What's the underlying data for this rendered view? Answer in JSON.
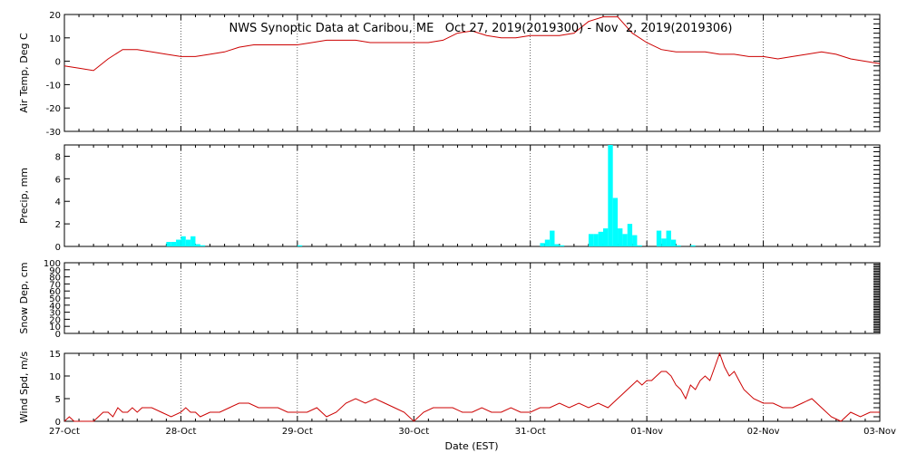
{
  "chart_data": {
    "type": "line",
    "title": "NWS Synoptic Data at Caribou, ME   Oct 27, 2019(2019300) - Nov  2, 2019(2019306)",
    "xlabel": "Date (EST)",
    "x_ticks": [
      "27-Oct",
      "28-Oct",
      "29-Oct",
      "30-Oct",
      "31-Oct",
      "01-Nov",
      "02-Nov",
      "03-Nov"
    ],
    "x_range_hours": [
      0,
      168
    ],
    "grid": "dotted at day boundaries",
    "panels": [
      {
        "id": "air-temp",
        "type": "line",
        "ylabel": "Air Temp, Deg C",
        "ylim": [
          -30,
          20
        ],
        "yticks": [
          -30,
          -20,
          -10,
          0,
          10,
          20
        ],
        "color": "#cc0000",
        "series": [
          {
            "x": [
              0,
              3,
              6,
              9,
              12,
              15,
              18,
              21,
              24,
              27,
              30,
              33,
              36,
              39,
              42,
              45,
              48,
              51,
              54,
              57,
              60,
              63,
              66,
              69,
              72,
              75,
              78,
              81,
              84,
              87,
              90,
              93,
              96,
              99,
              102,
              105,
              108,
              111,
              114,
              117,
              120,
              123,
              126,
              129,
              132,
              135,
              138,
              141,
              144,
              147,
              150,
              153,
              156,
              159,
              162,
              165,
              168
            ],
            "values": [
              -2,
              -3,
              -4,
              1,
              5,
              5,
              4,
              3,
              2,
              2,
              3,
              4,
              6,
              7,
              7,
              7,
              7,
              8,
              9,
              9,
              9,
              8,
              8,
              8,
              8,
              8,
              9,
              12,
              13,
              11,
              10,
              10,
              11,
              11,
              11,
              12,
              17,
              19,
              19,
              12,
              8,
              5,
              4,
              4,
              4,
              3,
              3,
              2,
              2,
              1,
              2,
              3,
              4,
              3,
              1,
              0,
              -1
            ]
          }
        ]
      },
      {
        "id": "precip",
        "type": "bar",
        "ylabel": "Precip, mm",
        "ylim": [
          0,
          9
        ],
        "yticks": [
          0,
          2,
          4,
          6,
          8
        ],
        "color": "#00ffff",
        "series": [
          {
            "x": [
              21,
              22,
              23,
              24,
              25,
              26,
              27,
              28,
              48,
              98,
              99,
              100,
              101,
              102,
              108,
              109,
              110,
              111,
              112,
              113,
              114,
              115,
              116,
              117,
              118,
              122,
              123,
              124,
              125,
              126,
              129
            ],
            "values": [
              0.4,
              0.4,
              0.6,
              0.9,
              0.6,
              0.9,
              0.2,
              0.1,
              0.1,
              0.3,
              0.6,
              1.4,
              0.2,
              0.1,
              1.1,
              1.1,
              1.3,
              1.6,
              9.8,
              4.3,
              1.6,
              1.1,
              2.0,
              1.0,
              0.1,
              1.4,
              0.7,
              1.4,
              0.6,
              0.1,
              0.1
            ]
          }
        ]
      },
      {
        "id": "snow-depth",
        "type": "line",
        "ylabel": "Snow Dep, cm",
        "ylim": [
          0,
          100
        ],
        "yticks": [
          0,
          10,
          20,
          30,
          40,
          50,
          60,
          70,
          80,
          90,
          100
        ],
        "color": "#cc0000",
        "series": [
          {
            "x": [],
            "values": []
          }
        ]
      },
      {
        "id": "wind-speed",
        "type": "line",
        "ylabel": "Wind Spd, m/s",
        "ylim": [
          0,
          15
        ],
        "yticks": [
          0,
          5,
          10,
          15
        ],
        "color": "#cc0000",
        "series": [
          {
            "x": [
              0,
              1,
              2,
              6,
              7,
              8,
              9,
              10,
              11,
              12,
              13,
              14,
              15,
              16,
              18,
              20,
              22,
              24,
              25,
              26,
              27,
              28,
              30,
              32,
              34,
              36,
              38,
              40,
              42,
              44,
              46,
              48,
              50,
              52,
              54,
              56,
              58,
              60,
              62,
              64,
              66,
              68,
              70,
              72,
              74,
              76,
              78,
              80,
              82,
              84,
              86,
              88,
              90,
              92,
              94,
              96,
              98,
              100,
              102,
              104,
              106,
              108,
              110,
              112,
              114,
              115,
              116,
              117,
              118,
              119,
              120,
              121,
              122,
              123,
              124,
              125,
              126,
              127,
              128,
              129,
              130,
              131,
              132,
              133,
              134,
              135,
              136,
              137,
              138,
              139,
              140,
              142,
              144,
              146,
              148,
              150,
              152,
              154,
              156,
              158,
              160,
              162,
              164,
              166,
              168
            ],
            "values": [
              0,
              1,
              0,
              0,
              1,
              2,
              2,
              1,
              3,
              2,
              2,
              3,
              2,
              3,
              3,
              2,
              1,
              2,
              3,
              2,
              2,
              1,
              2,
              2,
              3,
              4,
              4,
              3,
              3,
              3,
              2,
              2,
              2,
              3,
              1,
              2,
              4,
              5,
              4,
              5,
              4,
              3,
              2,
              0,
              2,
              3,
              3,
              3,
              2,
              2,
              3,
              2,
              2,
              3,
              2,
              2,
              3,
              3,
              4,
              3,
              4,
              3,
              4,
              3,
              5,
              6,
              7,
              8,
              9,
              8,
              9,
              9,
              10,
              11,
              11,
              10,
              8,
              7,
              5,
              8,
              7,
              9,
              10,
              9,
              12,
              15,
              12,
              10,
              11,
              9,
              7,
              5,
              4,
              4,
              3,
              3,
              4,
              5,
              3,
              1,
              0,
              2,
              1,
              2,
              2
            ]
          }
        ]
      }
    ]
  }
}
